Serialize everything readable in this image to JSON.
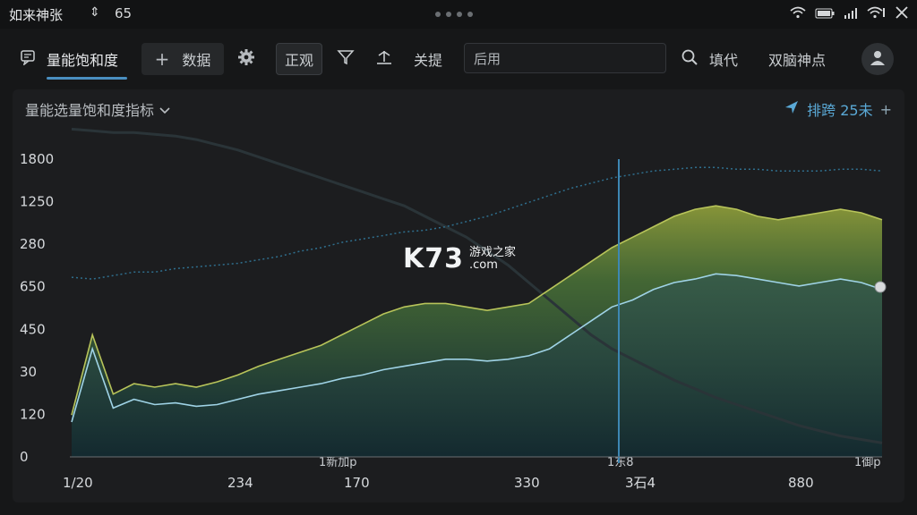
{
  "status_bar": {
    "title": "如来神张",
    "arrow": "⇕",
    "value": "65"
  },
  "toolbar": {
    "tab_active": "量能饱和度",
    "add_data": "数据",
    "mode_label": "正观",
    "item_close": "关提",
    "filter_placeholder": "后用",
    "search_label": "填代",
    "right_label": "双脑神点"
  },
  "panel": {
    "title": "量能选量饱和度指标",
    "meta": "排跨 25未"
  },
  "colors": {
    "accent": "#4a8fc0",
    "line_light": "#9fd3e6",
    "area_top": "#9aa84a",
    "area_mid": "#4e7a3e",
    "area_bottom": "#1d3b40",
    "spike_red": "#d6483c",
    "cursor": "#3d87b3"
  },
  "chart_data": {
    "type": "area",
    "y_ticks": [
      "1800",
      "1250",
      "280",
      "650",
      "450",
      "30",
      "120",
      "0"
    ],
    "x_ticks": [
      "1/20",
      "234",
      "170",
      "330",
      "3石4",
      "880"
    ],
    "x_sublabels": [
      "1新加p",
      "1东8",
      "1御p"
    ],
    "grid": false,
    "ylim": [
      0,
      1800
    ],
    "series": [
      {
        "values": [
          200,
          620,
          280,
          330,
          300,
          310,
          290,
          300,
          330,
          360,
          380,
          400,
          420,
          450,
          470,
          500,
          520,
          540,
          560,
          560,
          550,
          560,
          580,
          620,
          700,
          780,
          860,
          900,
          960,
          1000,
          1020,
          1050,
          1040,
          1020,
          1000,
          980,
          1000,
          1020,
          1000,
          960
        ]
      },
      {
        "values": [
          240,
          700,
          360,
          420,
          400,
          420,
          400,
          430,
          470,
          520,
          560,
          600,
          640,
          700,
          760,
          820,
          860,
          880,
          880,
          860,
          840,
          860,
          880,
          960,
          1040,
          1120,
          1200,
          1260,
          1320,
          1380,
          1420,
          1440,
          1420,
          1380,
          1360,
          1380,
          1400,
          1420,
          1400,
          1360
        ]
      },
      {
        "values": [
          1880,
          1870,
          1860,
          1860,
          1850,
          1840,
          1820,
          1790,
          1760,
          1720,
          1680,
          1640,
          1600,
          1560,
          1520,
          1480,
          1440,
          1380,
          1320,
          1260,
          1180,
          1100,
          1000,
          900,
          800,
          700,
          620,
          560,
          500,
          440,
          390,
          340,
          300,
          260,
          220,
          180,
          150,
          120,
          100,
          80
        ]
      },
      {
        "values": [
          1030,
          1020,
          1040,
          1060,
          1060,
          1080,
          1090,
          1100,
          1110,
          1130,
          1150,
          1180,
          1200,
          1230,
          1250,
          1270,
          1290,
          1300,
          1320,
          1350,
          1380,
          1420,
          1460,
          1500,
          1540,
          1570,
          1600,
          1620,
          1640,
          1650,
          1660,
          1660,
          1650,
          1650,
          1640,
          1640,
          1640,
          1650,
          1650,
          1640
        ]
      }
    ]
  }
}
